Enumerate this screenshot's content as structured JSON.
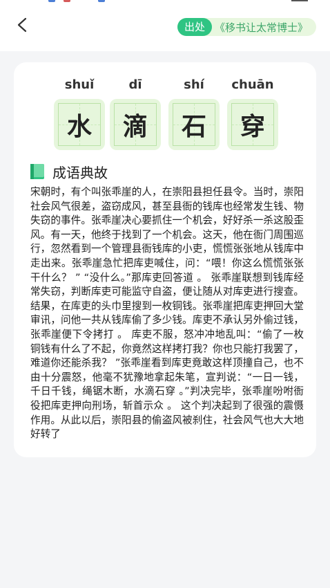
{
  "header": {
    "source_tag": "出处",
    "source_text": "《移书让太常博士》"
  },
  "idiom": {
    "characters": [
      {
        "pinyin": "shuǐ",
        "char": "水"
      },
      {
        "pinyin": "dī",
        "char": "滴"
      },
      {
        "pinyin": "shí",
        "char": "石"
      },
      {
        "pinyin": "chuān",
        "char": "穿"
      }
    ]
  },
  "story_section": {
    "title": "成语典故",
    "text": "宋朝时，有个叫张乖崖的人，在崇阳县担任县令。当时，崇阳社会风气很差，盗窃成风，甚至县衙的钱库也经常发生钱、物失窃的事件。张乖崖决心要抓住一个机会，好好杀一杀这股歪风。有一天，他终于找到了一个机会。这天，他在衙门周围巡行，忽然看到一个管理县衙钱库的小吏，慌慌张张地从钱库中走出来。张乖崖急忙把库吏喊住，问：“喂！你这么慌慌张张干什么？ ” “没什么。”那库吏回答道 。 张乖崖联想到钱库经常失窃，判断库吏可能监守自盗，便让随从对库吏进行搜查。结果，在库吏的头巾里搜到一枚铜钱。张乖崖把库吏押回大堂审讯，问他一共从钱库偷了多少钱。库吏不承认另外偷过钱，张乖崖便下令拷打 。 库吏不服，怒冲冲地乱叫：“偷了一枚铜钱有什么了不起，你竟然这样拷打我？你也只能打我罢了，难道你还能杀我？ ”张乖崖看到库吏竟敢这样顶撞自己，也不由十分震怒，他毫不犹豫地拿起朱笔，宣判说：“一日一钱，千日千钱，绳锯木断，水滴石穿 。”判决完毕，张乖崖吩咐衙役把库吏押向刑场，斩首示众 。 这个判决起到了很强的震慑作用。从此以后，崇阳县的偷盗风被刹住，社会风气也大大地好转了"
  },
  "icons": {
    "back": "chevron-left-icon",
    "section": "book-icon"
  },
  "colors": {
    "accent_green": "#2fc483",
    "pill_bg": "#e8f7df",
    "char_box_bg": "#e6f6dc",
    "page_bg": "#f4f5f7"
  }
}
